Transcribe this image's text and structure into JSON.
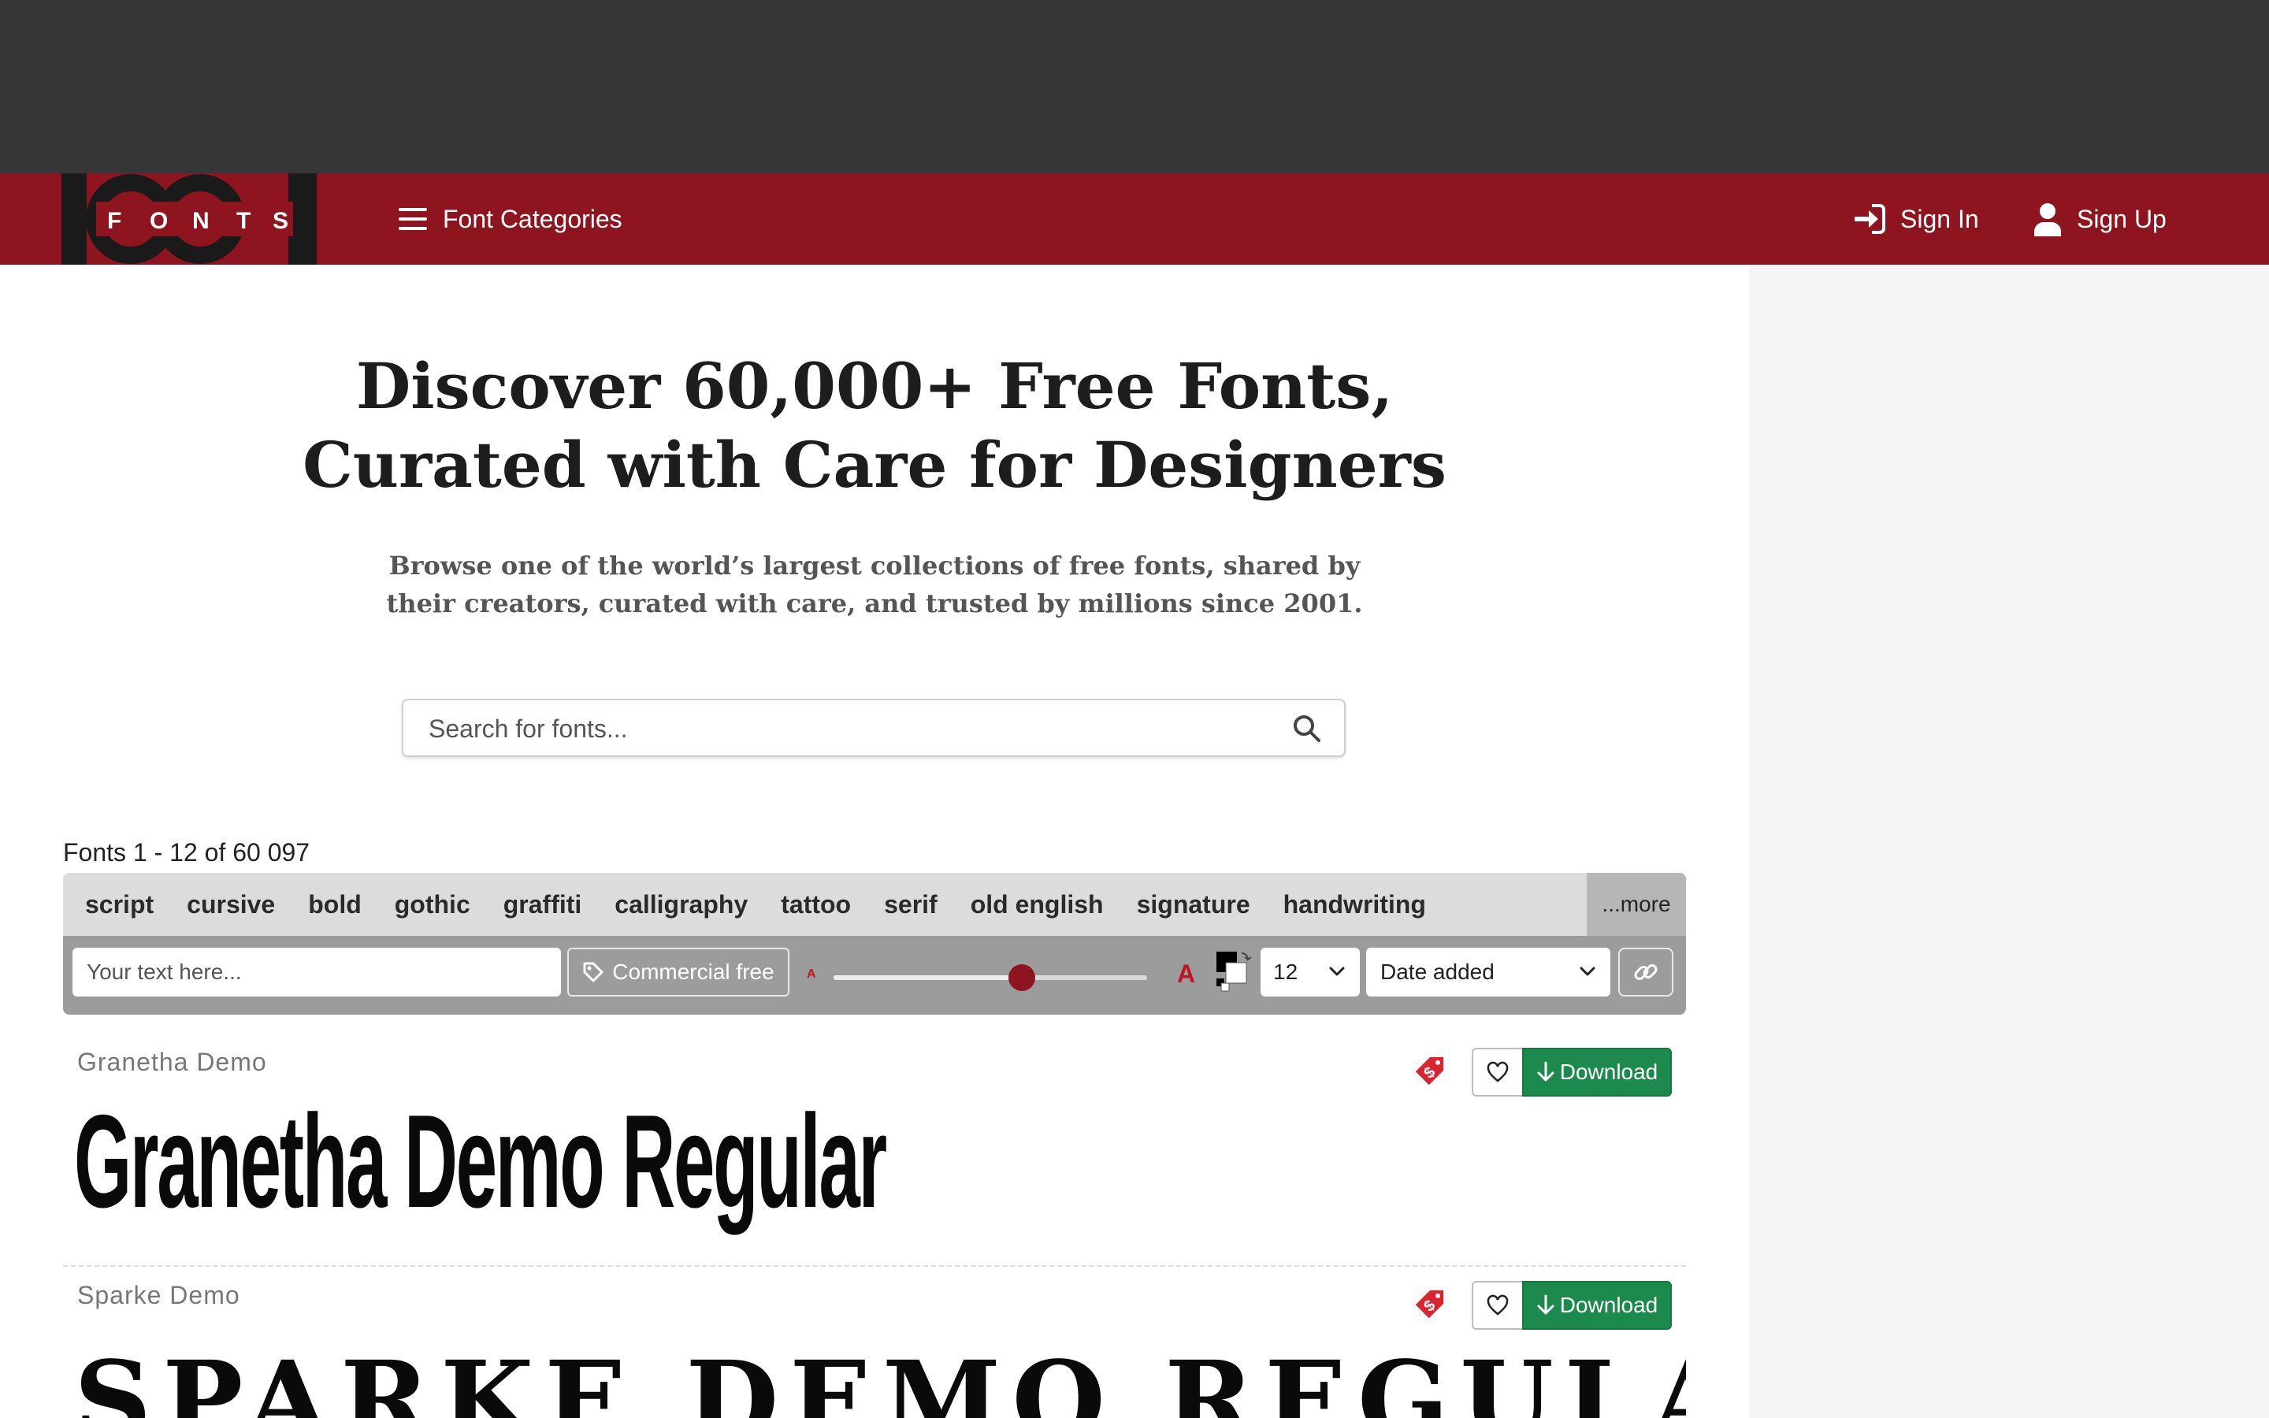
{
  "header": {
    "logo": {
      "digits": "1001",
      "letters": [
        "F",
        "O",
        "N",
        "T",
        "S"
      ]
    },
    "categories_label": "Font Categories",
    "sign_in_label": "Sign In",
    "sign_up_label": "Sign Up"
  },
  "hero": {
    "title": "Discover 60,000+ Free Fonts,\nCurated with Care for Designers",
    "subtitle": "Browse one of the world’s largest collections of free fonts, shared by\ntheir creators, curated with care, and trusted by millions since 2001.",
    "search_placeholder": "Search for fonts..."
  },
  "listing": {
    "count_text": "Fonts 1 - 12 of 60 097",
    "tags": [
      "script",
      "cursive",
      "bold",
      "gothic",
      "graffiti",
      "calligraphy",
      "tattoo",
      "serif",
      "old english",
      "signature",
      "handwriting"
    ],
    "more_label": "...more"
  },
  "controls": {
    "text_placeholder": "Your text here...",
    "commercial_label": "Commercial free",
    "size_small_label": "A",
    "size_large_label": "A",
    "size_slider_value": 0.6,
    "per_page_value": "12",
    "sort_value": "Date added"
  },
  "fonts": [
    {
      "name": "Granetha Demo",
      "preview": "Granetha Demo Regular",
      "download_label": "Download"
    },
    {
      "name": "Sparke Demo",
      "preview": "SPARKE DEMO REGULAR",
      "download_label": "Download"
    }
  ],
  "colors": {
    "brand_red": "#8e1520",
    "top_bar": "#363636",
    "download_green": "#1c8a4d",
    "price_tag_red": "#d8242f"
  }
}
